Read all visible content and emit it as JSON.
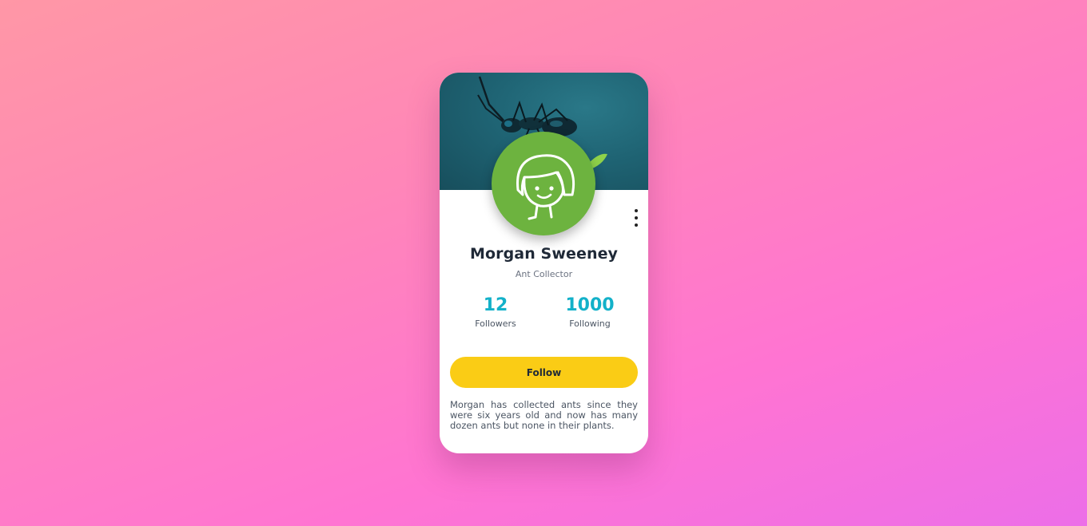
{
  "profile": {
    "name": "Morgan Sweeney",
    "title": "Ant Collector",
    "followers_count": "12",
    "followers_label": "Followers",
    "following_count": "1000",
    "following_label": "Following",
    "follow_label": "Follow",
    "bio": "Morgan has collected ants since they were six years old and now has many dozen ants but none in their plants."
  },
  "icons": {
    "avatar": "girl-face-illustration",
    "menu": "more-vertical-icon",
    "cover": "ant-photo"
  },
  "colors": {
    "accent": "#13b1c9",
    "button": "#facc15",
    "avatar_bg": "#6db33f",
    "cover_bg": "#1f6474"
  }
}
